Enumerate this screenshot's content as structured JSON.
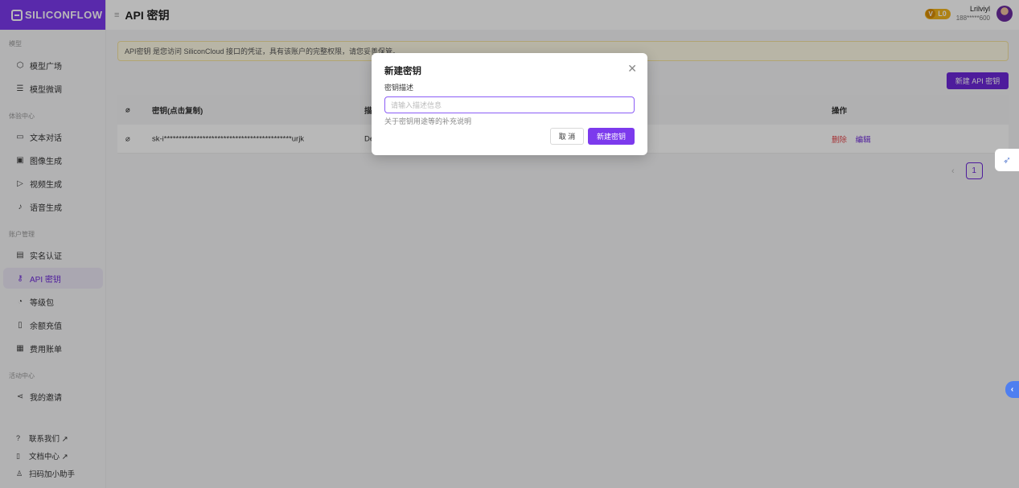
{
  "brand": {
    "logo_text": "SILICONFLOW"
  },
  "sidebar": {
    "sections": [
      {
        "label": "模型"
      },
      {
        "label": "体验中心"
      },
      {
        "label": "账户管理"
      },
      {
        "label": "活动中心"
      }
    ],
    "items": [
      {
        "label": "模型广场",
        "icon": "cube-icon"
      },
      {
        "label": "模型微调",
        "icon": "sliders-icon"
      },
      {
        "label": "文本对话",
        "icon": "chat-icon"
      },
      {
        "label": "图像生成",
        "icon": "image-icon"
      },
      {
        "label": "视频生成",
        "icon": "video-icon"
      },
      {
        "label": "语音生成",
        "icon": "mic-icon"
      },
      {
        "label": "实名认证",
        "icon": "id-card-icon"
      },
      {
        "label": "API 密钥",
        "icon": "key-icon",
        "active": true
      },
      {
        "label": "等级包",
        "icon": "gauge-icon"
      },
      {
        "label": "余额充值",
        "icon": "wallet-icon"
      },
      {
        "label": "费用账单",
        "icon": "bill-icon"
      },
      {
        "label": "我的邀请",
        "icon": "share-icon"
      }
    ],
    "bottom": [
      {
        "label": "联系我们 ↗",
        "icon": "help-circle-icon"
      },
      {
        "label": "文档中心 ↗",
        "icon": "document-icon"
      },
      {
        "label": "扫码加小助手",
        "icon": "user-icon"
      }
    ]
  },
  "header": {
    "title": "API 密钥",
    "level": "L0",
    "user_name": "Lrilviyl",
    "user_phone": "188*****600"
  },
  "notice": "API密钥 是您访问 SiliconCloud 接口的凭证，具有该账户的完整权限，请您妥善保管。",
  "new_key_button": "新建 API 密钥",
  "table": {
    "headers": {
      "key": "密钥(点击复制)",
      "desc": "描",
      "actions": "操作"
    },
    "rows": [
      {
        "key": "sk-i*******************************************urjk",
        "desc": "De",
        "delete": "删除",
        "edit": "编辑"
      }
    ]
  },
  "pagination": {
    "current": "1"
  },
  "modal": {
    "title": "新建密钥",
    "field_label": "密钥描述",
    "placeholder": "请输入描述信息",
    "help": "关于密钥用途等的补充说明",
    "cancel": "取 消",
    "confirm": "新建密钥"
  },
  "colors": {
    "accent": "#7c3aed",
    "danger": "#e5484d",
    "notice_bg": "#fffbe6"
  }
}
